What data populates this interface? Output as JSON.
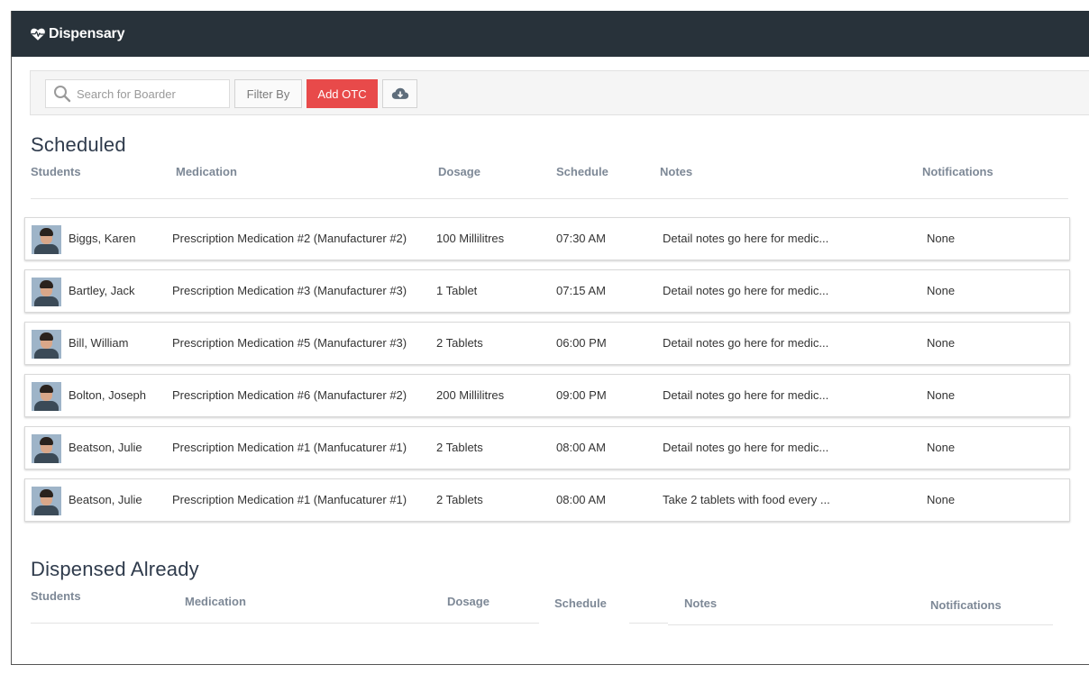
{
  "header": {
    "title": "Dispensary",
    "icon": "heartbeat-icon"
  },
  "toolbar": {
    "search_placeholder": "Search for Boarder",
    "filter_label": "Filter By",
    "add_label": "Add OTC",
    "download_icon": "cloud-download-icon"
  },
  "scheduled": {
    "title": "Scheduled",
    "columns": {
      "students": "Students",
      "medication": "Medication",
      "dosage": "Dosage",
      "schedule": "Schedule",
      "notes": "Notes",
      "notifications": "Notifications"
    },
    "rows": [
      {
        "student": "Biggs, Karen",
        "medication": "Prescription Medication #2 (Manufacturer #2)",
        "dosage": "100 Millilitres",
        "schedule": "07:30 AM",
        "notes": "Detail notes go here for medic...",
        "notifications": "None"
      },
      {
        "student": "Bartley, Jack",
        "medication": "Prescription Medication #3 (Manufacturer #3)",
        "dosage": "1 Tablet",
        "schedule": "07:15 AM",
        "notes": "Detail notes go here for medic...",
        "notifications": "None"
      },
      {
        "student": "Bill, William",
        "medication": "Prescription Medication #5 (Manufacturer #3)",
        "dosage": "2 Tablets",
        "schedule": "06:00 PM",
        "notes": "Detail notes go here for medic...",
        "notifications": "None"
      },
      {
        "student": "Bolton, Joseph",
        "medication": "Prescription Medication #6 (Manufacturer #2)",
        "dosage": "200 Millilitres",
        "schedule": "09:00 PM",
        "notes": "Detail notes go here for medic...",
        "notifications": "None"
      },
      {
        "student": "Beatson, Julie",
        "medication": "Prescription Medication #1 (Manfucaturer #1)",
        "dosage": "2 Tablets",
        "schedule": "08:00 AM",
        "notes": "Detail notes go here for medic...",
        "notifications": "None"
      },
      {
        "student": "Beatson, Julie",
        "medication": "Prescription Medication #1 (Manfucaturer #1)",
        "dosage": "2 Tablets",
        "schedule": "08:00 AM",
        "notes": "Take 2 tablets with food every ...",
        "notifications": "None"
      }
    ]
  },
  "dispensed": {
    "title": "Dispensed Already",
    "columns": {
      "students": "Students",
      "medication": "Medication",
      "dosage": "Dosage",
      "schedule": "Schedule",
      "notes": "Notes",
      "notifications": "Notifications"
    }
  },
  "colors": {
    "topbar": "#28323a",
    "accent_red": "#e84a4a",
    "heading": "#2f3b4c",
    "column_header": "#7d8896"
  }
}
